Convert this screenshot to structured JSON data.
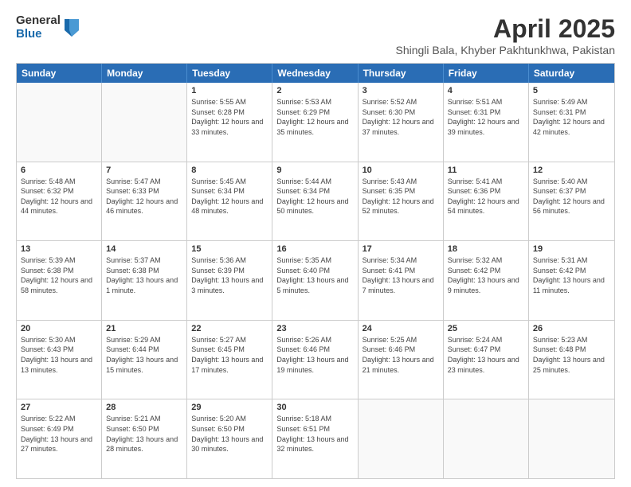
{
  "logo": {
    "general": "General",
    "blue": "Blue"
  },
  "title": "April 2025",
  "subtitle": "Shingli Bala, Khyber Pakhtunkhwa, Pakistan",
  "header_days": [
    "Sunday",
    "Monday",
    "Tuesday",
    "Wednesday",
    "Thursday",
    "Friday",
    "Saturday"
  ],
  "weeks": [
    [
      {
        "day": "",
        "empty": true
      },
      {
        "day": "",
        "empty": true
      },
      {
        "day": "1",
        "rise": "5:55 AM",
        "set": "6:28 PM",
        "daylight": "12 hours and 33 minutes."
      },
      {
        "day": "2",
        "rise": "5:53 AM",
        "set": "6:29 PM",
        "daylight": "12 hours and 35 minutes."
      },
      {
        "day": "3",
        "rise": "5:52 AM",
        "set": "6:30 PM",
        "daylight": "12 hours and 37 minutes."
      },
      {
        "day": "4",
        "rise": "5:51 AM",
        "set": "6:31 PM",
        "daylight": "12 hours and 39 minutes."
      },
      {
        "day": "5",
        "rise": "5:49 AM",
        "set": "6:31 PM",
        "daylight": "12 hours and 42 minutes."
      }
    ],
    [
      {
        "day": "6",
        "rise": "5:48 AM",
        "set": "6:32 PM",
        "daylight": "12 hours and 44 minutes."
      },
      {
        "day": "7",
        "rise": "5:47 AM",
        "set": "6:33 PM",
        "daylight": "12 hours and 46 minutes."
      },
      {
        "day": "8",
        "rise": "5:45 AM",
        "set": "6:34 PM",
        "daylight": "12 hours and 48 minutes."
      },
      {
        "day": "9",
        "rise": "5:44 AM",
        "set": "6:34 PM",
        "daylight": "12 hours and 50 minutes."
      },
      {
        "day": "10",
        "rise": "5:43 AM",
        "set": "6:35 PM",
        "daylight": "12 hours and 52 minutes."
      },
      {
        "day": "11",
        "rise": "5:41 AM",
        "set": "6:36 PM",
        "daylight": "12 hours and 54 minutes."
      },
      {
        "day": "12",
        "rise": "5:40 AM",
        "set": "6:37 PM",
        "daylight": "12 hours and 56 minutes."
      }
    ],
    [
      {
        "day": "13",
        "rise": "5:39 AM",
        "set": "6:38 PM",
        "daylight": "12 hours and 58 minutes."
      },
      {
        "day": "14",
        "rise": "5:37 AM",
        "set": "6:38 PM",
        "daylight": "13 hours and 1 minute."
      },
      {
        "day": "15",
        "rise": "5:36 AM",
        "set": "6:39 PM",
        "daylight": "13 hours and 3 minutes."
      },
      {
        "day": "16",
        "rise": "5:35 AM",
        "set": "6:40 PM",
        "daylight": "13 hours and 5 minutes."
      },
      {
        "day": "17",
        "rise": "5:34 AM",
        "set": "6:41 PM",
        "daylight": "13 hours and 7 minutes."
      },
      {
        "day": "18",
        "rise": "5:32 AM",
        "set": "6:42 PM",
        "daylight": "13 hours and 9 minutes."
      },
      {
        "day": "19",
        "rise": "5:31 AM",
        "set": "6:42 PM",
        "daylight": "13 hours and 11 minutes."
      }
    ],
    [
      {
        "day": "20",
        "rise": "5:30 AM",
        "set": "6:43 PM",
        "daylight": "13 hours and 13 minutes."
      },
      {
        "day": "21",
        "rise": "5:29 AM",
        "set": "6:44 PM",
        "daylight": "13 hours and 15 minutes."
      },
      {
        "day": "22",
        "rise": "5:27 AM",
        "set": "6:45 PM",
        "daylight": "13 hours and 17 minutes."
      },
      {
        "day": "23",
        "rise": "5:26 AM",
        "set": "6:46 PM",
        "daylight": "13 hours and 19 minutes."
      },
      {
        "day": "24",
        "rise": "5:25 AM",
        "set": "6:46 PM",
        "daylight": "13 hours and 21 minutes."
      },
      {
        "day": "25",
        "rise": "5:24 AM",
        "set": "6:47 PM",
        "daylight": "13 hours and 23 minutes."
      },
      {
        "day": "26",
        "rise": "5:23 AM",
        "set": "6:48 PM",
        "daylight": "13 hours and 25 minutes."
      }
    ],
    [
      {
        "day": "27",
        "rise": "5:22 AM",
        "set": "6:49 PM",
        "daylight": "13 hours and 27 minutes."
      },
      {
        "day": "28",
        "rise": "5:21 AM",
        "set": "6:50 PM",
        "daylight": "13 hours and 28 minutes."
      },
      {
        "day": "29",
        "rise": "5:20 AM",
        "set": "6:50 PM",
        "daylight": "13 hours and 30 minutes."
      },
      {
        "day": "30",
        "rise": "5:18 AM",
        "set": "6:51 PM",
        "daylight": "13 hours and 32 minutes."
      },
      {
        "day": "",
        "empty": true
      },
      {
        "day": "",
        "empty": true
      },
      {
        "day": "",
        "empty": true
      }
    ]
  ]
}
